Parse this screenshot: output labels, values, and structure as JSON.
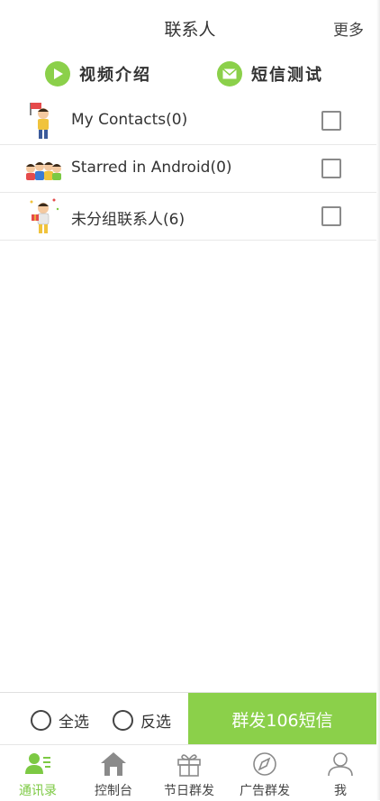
{
  "header": {
    "title": "联系人",
    "more_label": "更多"
  },
  "actions": {
    "video_label": "视频介绍",
    "sms_test_label": "短信测试"
  },
  "groups": [
    {
      "label": "My Contacts(0)",
      "checked": false
    },
    {
      "label": "Starred in Android(0)",
      "checked": false
    },
    {
      "label": "未分组联系人(6)",
      "checked": false
    }
  ],
  "bottom_bar": {
    "select_all_label": "全选",
    "invert_label": "反选",
    "send_label": "群发106短信"
  },
  "tabs": [
    {
      "label": "通讯录",
      "active": true
    },
    {
      "label": "控制台",
      "active": false
    },
    {
      "label": "节日群发",
      "active": false
    },
    {
      "label": "广告群发",
      "active": false
    },
    {
      "label": "我",
      "active": false
    }
  ],
  "colors": {
    "accent": "#8bd04a",
    "active_tab": "#7cc943"
  }
}
